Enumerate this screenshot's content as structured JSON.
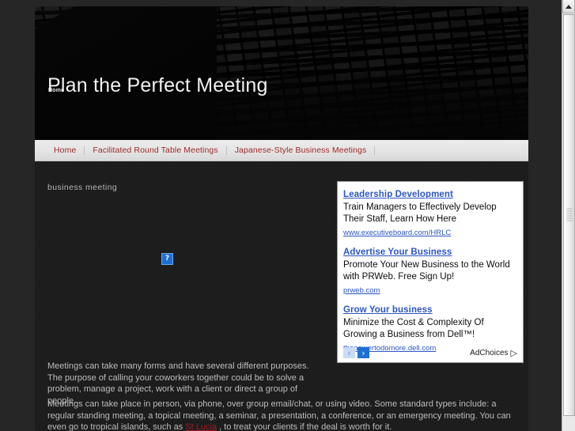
{
  "header": {
    "site_title": "Plan the Perfect Meeting",
    "home_overlay": "Home"
  },
  "nav": {
    "items": [
      {
        "label": "Home"
      },
      {
        "label": "Facilitated Round Table Meetings"
      },
      {
        "label": "Japanese-Style Business Meetings"
      }
    ]
  },
  "content": {
    "image_alt": "business meeting",
    "broken_image_glyph": "?",
    "paragraph_1": "Meetings can take many forms and have several different purposes. The purpose of calling your coworkers together could be to solve a problem, manage a project, work with a client or direct a group of people.",
    "paragraph_2_before": "Meetings can take place in person, via phone, over group email/chat, or using video.  Some standard types include: a regular standing meeting, a topical meeting, a seminar, a presentation, a conference, or an emergency meeting. You can even go to tropical islands, such as ",
    "paragraph_2_link": "St Lucia",
    "paragraph_2_after": " , to treat your clients if the deal is worth for it."
  },
  "ads": {
    "units": [
      {
        "title": "Leadership Development",
        "body": "Train Managers to Effectively Develop Their Staff, Learn How Here",
        "url": "www.executiveboard.com/HRLC"
      },
      {
        "title": "Advertise Your Business",
        "body": "Promote Your New Business to the World with PRWeb. Free Sign Up!",
        "url": "prweb.com"
      },
      {
        "title": "Grow Your business",
        "body": "Minimize the Cost & Complexity Of Growing a Business from Dell™!",
        "url": "thepowertodomore.dell.com"
      }
    ],
    "prev_label": "‹",
    "next_label": "›",
    "adchoices_label": "AdChoices",
    "adchoices_icon": "▷"
  },
  "scrollbar": {
    "up_arrow": "up-arrow"
  },
  "colors": {
    "nav_link": "#9e2a28",
    "ad_link": "#2b56c4",
    "body_text": "#bdbdbd",
    "page_bg": "#262626",
    "content_bg": "#1c1c1c",
    "inline_link": "#9e1f1f"
  }
}
